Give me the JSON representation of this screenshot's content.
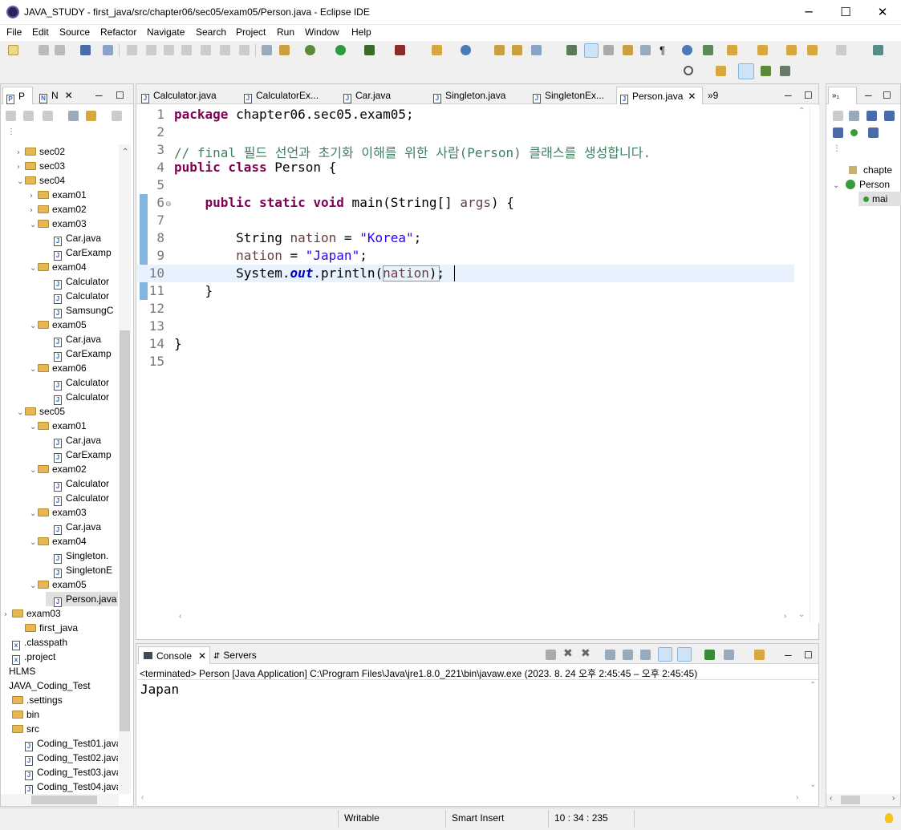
{
  "window": {
    "title": "JAVA_STUDY - first_java/src/chapter06/sec05/exam05/Person.java - Eclipse IDE"
  },
  "menu": [
    "File",
    "Edit",
    "Source",
    "Refactor",
    "Navigate",
    "Search",
    "Project",
    "Run",
    "Window",
    "Help"
  ],
  "left_panel": {
    "tabs": [
      "P",
      "N"
    ],
    "tree": [
      {
        "label": "sec02",
        "type": "folder",
        "arrow": "›"
      },
      {
        "label": "sec03",
        "type": "folder",
        "arrow": "›"
      },
      {
        "label": "sec04",
        "type": "folder",
        "arrow": "⌄"
      },
      {
        "label": "exam01",
        "type": "folder",
        "arrow": "›"
      },
      {
        "label": "exam02",
        "type": "folder",
        "arrow": "›"
      },
      {
        "label": "exam03",
        "type": "folder",
        "arrow": "⌄"
      },
      {
        "label": "Car.java",
        "type": "file"
      },
      {
        "label": "CarExamp",
        "type": "file"
      },
      {
        "label": "exam04",
        "type": "folder",
        "arrow": "⌄"
      },
      {
        "label": "Calculator",
        "type": "file"
      },
      {
        "label": "Calculator",
        "type": "file"
      },
      {
        "label": "SamsungC",
        "type": "file"
      },
      {
        "label": "exam05",
        "type": "folder",
        "arrow": "⌄"
      },
      {
        "label": "Car.java",
        "type": "file"
      },
      {
        "label": "CarExamp",
        "type": "file"
      },
      {
        "label": "exam06",
        "type": "folder",
        "arrow": "⌄"
      },
      {
        "label": "Calculator",
        "type": "file"
      },
      {
        "label": "Calculator",
        "type": "file"
      },
      {
        "label": "sec05",
        "type": "folder",
        "arrow": "⌄"
      },
      {
        "label": "exam01",
        "type": "folder",
        "arrow": "⌄"
      },
      {
        "label": "Car.java",
        "type": "file"
      },
      {
        "label": "CarExamp",
        "type": "file"
      },
      {
        "label": "exam02",
        "type": "folder",
        "arrow": "⌄"
      },
      {
        "label": "Calculator",
        "type": "file"
      },
      {
        "label": "Calculator",
        "type": "file"
      },
      {
        "label": "exam03",
        "type": "folder",
        "arrow": "⌄"
      },
      {
        "label": "Car.java",
        "type": "file"
      },
      {
        "label": "exam04",
        "type": "folder",
        "arrow": "⌄"
      },
      {
        "label": "Singleton.",
        "type": "file"
      },
      {
        "label": "SingletonE",
        "type": "file"
      },
      {
        "label": "exam05",
        "type": "folder",
        "arrow": "⌄"
      },
      {
        "label": "Person.java",
        "type": "file",
        "selected": true
      },
      {
        "label": "exam03",
        "type": "folder",
        "arrow": "›"
      },
      {
        "label": "first_java",
        "type": "folder"
      },
      {
        "label": ".classpath",
        "type": "xfile"
      },
      {
        "label": ".project",
        "type": "xfile"
      },
      {
        "label": "HLMS",
        "type": "project"
      },
      {
        "label": "JAVA_Coding_Test",
        "type": "project"
      },
      {
        "label": ".settings",
        "type": "folder"
      },
      {
        "label": "bin",
        "type": "folder"
      },
      {
        "label": "src",
        "type": "folder"
      },
      {
        "label": "Coding_Test01.java",
        "type": "file"
      },
      {
        "label": "Coding_Test02.java",
        "type": "file"
      },
      {
        "label": "Coding_Test03.java",
        "type": "file"
      },
      {
        "label": "Coding_Test04.java",
        "type": "file"
      }
    ]
  },
  "editor": {
    "tabs": [
      {
        "label": "Calculator.java"
      },
      {
        "label": "CalculatorEx..."
      },
      {
        "label": "Car.java"
      },
      {
        "label": "Singleton.java"
      },
      {
        "label": "SingletonEx..."
      },
      {
        "label": "Person.java",
        "active": true
      }
    ],
    "overflow": "»9",
    "lines": [
      {
        "n": "1",
        "tokens": [
          [
            "kw",
            "package"
          ],
          [
            "p",
            " chapter06.sec05.exam05;"
          ]
        ]
      },
      {
        "n": "2",
        "tokens": []
      },
      {
        "n": "3",
        "tokens": [
          [
            "cm",
            "// final 필드 선언과 초기화 이해를 위한 사람(Person) 클래스를 생성합니다."
          ]
        ]
      },
      {
        "n": "4",
        "tokens": [
          [
            "kw",
            "public class"
          ],
          [
            "p",
            " Person {"
          ]
        ]
      },
      {
        "n": "5",
        "tokens": []
      },
      {
        "n": "6",
        "tokens": [
          [
            "p",
            "    "
          ],
          [
            "kw",
            "public static void"
          ],
          [
            "p",
            " main(String[] "
          ],
          [
            "var",
            "args"
          ],
          [
            "p",
            ") {"
          ]
        ]
      },
      {
        "n": "7",
        "tokens": []
      },
      {
        "n": "8",
        "tokens": [
          [
            "p",
            "        String "
          ],
          [
            "var",
            "nation"
          ],
          [
            "p",
            " = "
          ],
          [
            "str",
            "\"Korea\""
          ],
          [
            "p",
            ";"
          ]
        ]
      },
      {
        "n": "9",
        "tokens": [
          [
            "p",
            "        "
          ],
          [
            "var",
            "nation"
          ],
          [
            "p",
            " = "
          ],
          [
            "str",
            "\"Japan\""
          ],
          [
            "p",
            ";"
          ]
        ]
      },
      {
        "n": "10",
        "tokens": [
          [
            "p",
            "        System."
          ],
          [
            "fld",
            "out"
          ],
          [
            "p",
            ".println("
          ],
          [
            "var",
            "nation"
          ],
          [
            "p",
            ");"
          ]
        ]
      },
      {
        "n": "11",
        "tokens": [
          [
            "p",
            "    }"
          ]
        ]
      },
      {
        "n": "12",
        "tokens": []
      },
      {
        "n": "13",
        "tokens": []
      },
      {
        "n": "14",
        "tokens": [
          [
            "p",
            "}"
          ]
        ]
      },
      {
        "n": "15",
        "tokens": []
      }
    ]
  },
  "outline": {
    "items": [
      {
        "label": "chapte"
      },
      {
        "label": "Person"
      },
      {
        "label": "mai"
      }
    ]
  },
  "console": {
    "tabs": [
      "Console",
      "Servers"
    ],
    "terminated": "<terminated> Person [Java Application] C:\\Program Files\\Java\\jre1.8.0_221\\bin\\javaw.exe  (2023. 8. 24 오후 2:45:45 – 오후 2:45:45)",
    "output": "Japan"
  },
  "status_bar": {
    "writable": "Writable",
    "insert_mode": "Smart Insert",
    "position": "10 : 34 : 235"
  },
  "colors": {
    "keyword": "#7f0055",
    "string": "#2a00ff",
    "comment": "#3f7f5f",
    "local_var": "#6a3e3e",
    "field": "#0000c0",
    "current_line": "#e8f2fe"
  }
}
